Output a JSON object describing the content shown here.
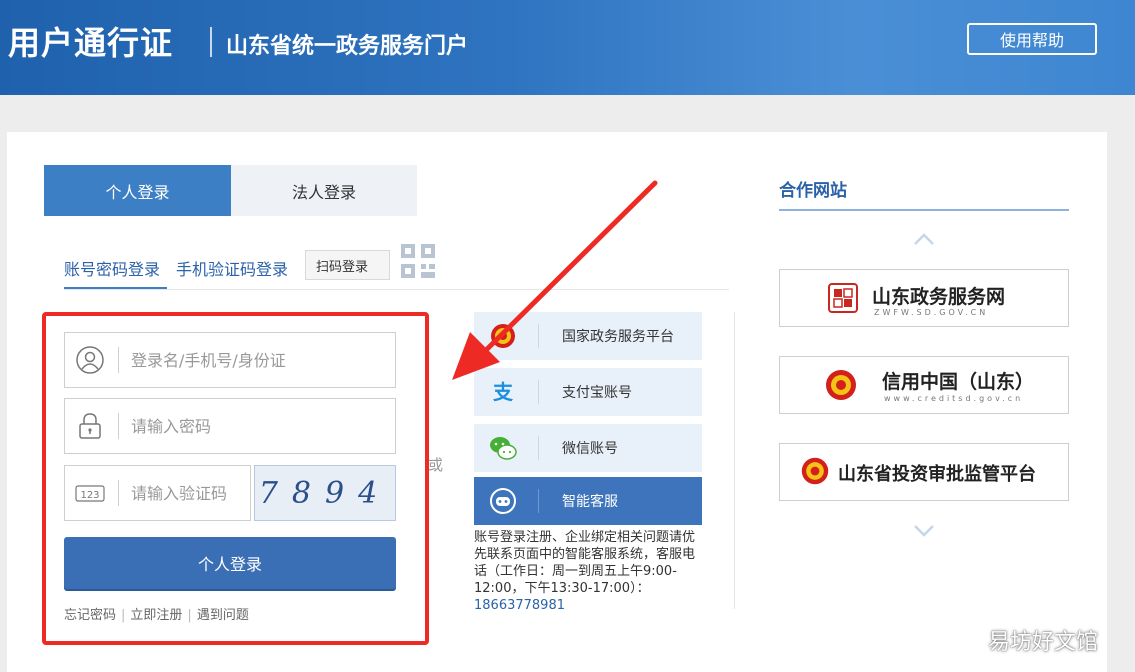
{
  "header": {
    "brand": "用户通行证",
    "subtitle": "山东省统一政务服务门户",
    "help_label": "使用帮助"
  },
  "tabs": {
    "personal": "个人登录",
    "legal": "法人登录"
  },
  "subtabs": {
    "account": "账号密码登录",
    "sms": "手机验证码登录",
    "scan": "扫码登录"
  },
  "form": {
    "username_placeholder": "登录名/手机号/身份证",
    "password_placeholder": "请输入密码",
    "captcha_placeholder": "请输入验证码",
    "captcha_code": "7894",
    "login_label": "个人登录",
    "links": [
      "忘记密码",
      "立即注册",
      "遇到问题"
    ]
  },
  "or_text": "或",
  "third_party": [
    {
      "label": "国家政务服务平台",
      "icon": "national-emblem-icon"
    },
    {
      "label": "支付宝账号",
      "icon": "alipay-icon"
    },
    {
      "label": "微信账号",
      "icon": "wechat-icon"
    },
    {
      "label": "智能客服",
      "icon": "robot-icon"
    }
  ],
  "notice": {
    "text": "账号登录注册、企业绑定相关问题请优先联系页面中的智能客服系统，客服电话（工作日：周一到周五上午9:00-12:00，下午13:30-17:00）：",
    "phone": "18663778981"
  },
  "partner": {
    "title": "合作网站",
    "sites": [
      {
        "name": "山东政务服务网",
        "url": "ZWFW.SD.GOV.CN"
      },
      {
        "name": "信用中国（山东）",
        "url": "www.creditsd.gov.cn"
      },
      {
        "name": "山东省投资审批监管平台",
        "url": ""
      }
    ]
  },
  "watermark": "易坊好文馆",
  "colors": {
    "header_blue": "#2f74c0",
    "accent_blue": "#3d7fc5",
    "annotation_red": "#ee2a24"
  }
}
